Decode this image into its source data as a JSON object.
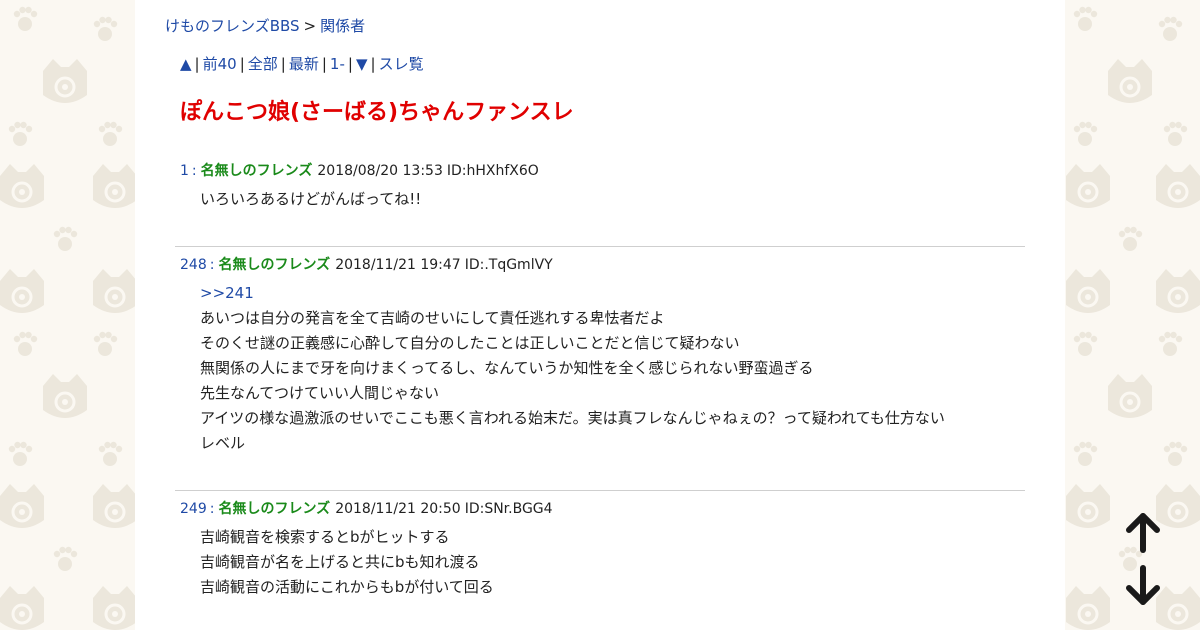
{
  "breadcrumb": {
    "board": "けものフレンズBBS",
    "separator": ">",
    "category": "関係者"
  },
  "thread_nav": {
    "up": "▲",
    "prev": "前40",
    "all": "全部",
    "latest": "最新",
    "first": "1-",
    "down": "▼",
    "list": "スレ覧",
    "sep": "|"
  },
  "thread_title": "ぽんこつ娘(さーばる)ちゃんファンスレ",
  "posts": [
    {
      "number": "1",
      "colon": ":",
      "name": "名無しのフレンズ",
      "date": "2018/08/20 13:53",
      "id": "ID:hHXhfX6O",
      "lines": [
        "いろいろあるけどがんばってね!!"
      ]
    },
    {
      "number": "248",
      "colon": ":",
      "name": "名無しのフレンズ",
      "date": "2018/11/21 19:47",
      "id": "ID:.TqGmlVY",
      "reply_anchor": ">>241",
      "lines": [
        "あいつは自分の発言を全て吉崎のせいにして責任逃れする卑怯者だよ",
        "そのくせ謎の正義感に心酔して自分のしたことは正しいことだと信じて疑わない",
        "無関係の人にまで牙を向けまくってるし、なんていうか知性を全く感じられない野蛮過ぎる",
        "先生なんてつけていい人間じゃない",
        "アイツの様な過激派のせいでここも悪く言われる始末だ。実は真フレなんじゃねぇの？って疑われても仕方ない",
        "レベル"
      ]
    },
    {
      "number": "249",
      "colon": ":",
      "name": "名無しのフレンズ",
      "date": "2018/11/21 20:50",
      "id": "ID:SNr.BGG4",
      "lines": [
        "吉崎観音を検索するとbがヒットする",
        "吉崎観音が名を上げると共にbも知れ渡る",
        "吉崎観音の活動にこれからもbが付いて回る"
      ]
    }
  ],
  "scroll_controls": {
    "up_icon": "arrow-up-icon",
    "down_icon": "arrow-down-icon"
  },
  "colors": {
    "link": "#1f4aa6",
    "title": "#e00000",
    "name": "#1a8a1a",
    "background": "#fbf8f2",
    "pattern": "#ece7dc"
  }
}
